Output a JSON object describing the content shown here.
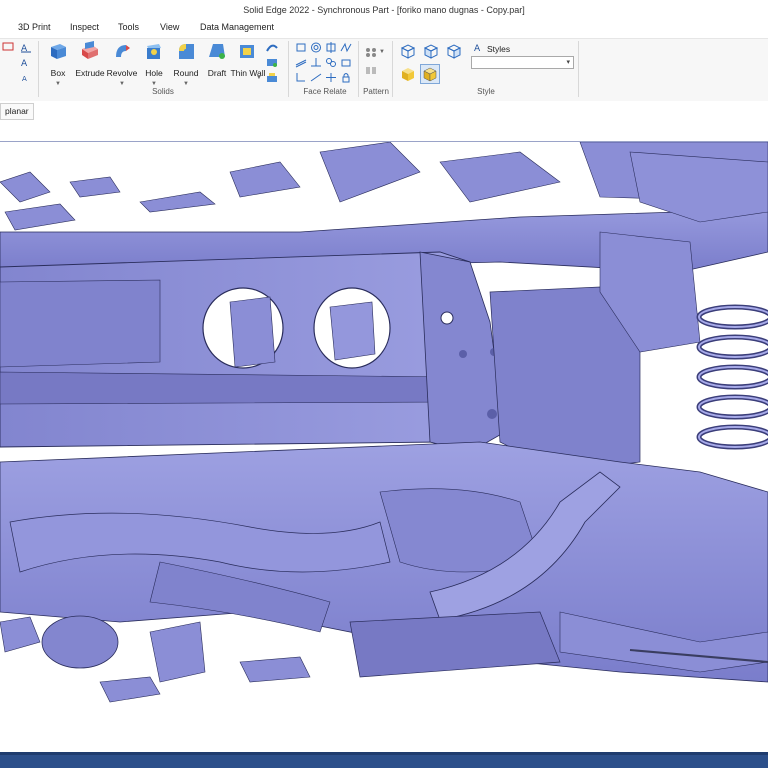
{
  "window": {
    "title": "Solid Edge 2022 - Synchronous Part - [foriko mano dugnas - Copy.par]"
  },
  "menu": {
    "tabs": [
      {
        "label": "3D Print"
      },
      {
        "label": "Inspect"
      },
      {
        "label": "Tools"
      },
      {
        "label": "View"
      },
      {
        "label": "Data Management"
      }
    ]
  },
  "ribbon": {
    "solids": {
      "label": "Solids",
      "buttons": [
        {
          "label": "Box"
        },
        {
          "label": "Extrude"
        },
        {
          "label": "Revolve"
        },
        {
          "label": "Hole"
        },
        {
          "label": "Round"
        },
        {
          "label": "Draft"
        },
        {
          "label": "Thin Wall"
        }
      ]
    },
    "face_relate": {
      "label": "Face Relate"
    },
    "pattern": {
      "label": "Pattern"
    },
    "style": {
      "label": "Style",
      "styles_label": "Styles",
      "styles_value": ""
    }
  },
  "subbar": {
    "chip": "planar"
  },
  "colors": {
    "model": "#8b8ed6",
    "model_dark": "#5b5fa8",
    "model_edge": "#2a2d5c",
    "statusbar": "#2c4f8a",
    "accent": "#1f6fc4"
  }
}
